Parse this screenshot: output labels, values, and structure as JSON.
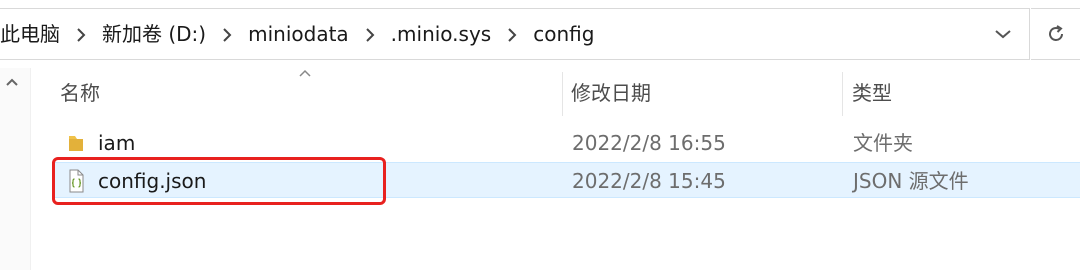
{
  "breadcrumb": [
    "此电脑",
    "新加卷 (D:)",
    "miniodata",
    ".minio.sys",
    "config"
  ],
  "columns": {
    "name": "名称",
    "date": "修改日期",
    "type": "类型"
  },
  "files": [
    {
      "name": "iam",
      "date": "2022/2/8 16:55",
      "type": "文件夹",
      "icon": "folder-icon"
    },
    {
      "name": "config.json",
      "date": "2022/2/8 15:45",
      "type": "JSON 源文件",
      "icon": "json-file-icon"
    }
  ],
  "colors": {
    "selection": "#e5f3ff",
    "highlight": "#e8211f",
    "folder": "#f0c24a"
  }
}
